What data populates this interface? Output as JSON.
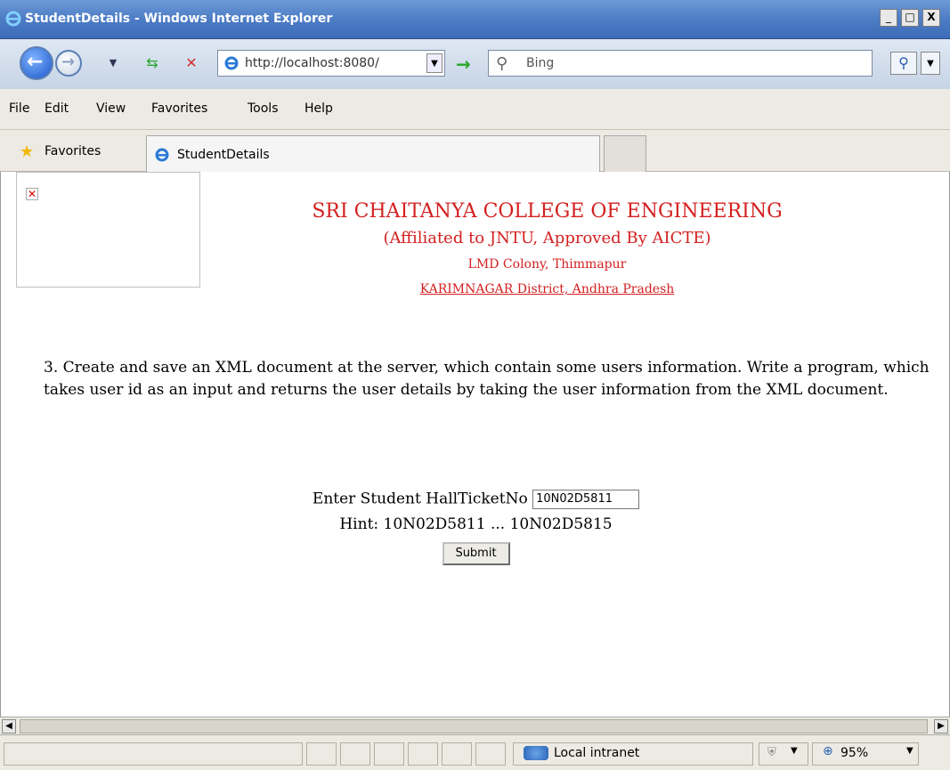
{
  "window": {
    "title": "StudentDetails - Windows Internet Explorer",
    "minimize": "_",
    "maximize": "□",
    "close": "X"
  },
  "address": {
    "url": "http://localhost:8080/",
    "search_placeholder": "Bing"
  },
  "menu": [
    "File",
    "Edit",
    "View",
    "Favorites",
    "Tools",
    "Help"
  ],
  "favorites": {
    "label": "Favorites",
    "tab_label": "StudentDetails"
  },
  "header": {
    "line1": "SRI CHAITANYA COLLEGE OF ENGINEERING",
    "line2": "(Affiliated to JNTU, Approved By AICTE)",
    "line3": "LMD Colony, Thimmapur",
    "line4": "KARIMNAGAR District, Andhra Pradesh"
  },
  "question": "3. Create and save an XML document at the server, which contain some users information. Write a program, which takes user id as an input and returns the user details by taking the user information from the XML document.",
  "form": {
    "label": "Enter Student HallTicketNo",
    "value": "10N02D5811",
    "hint": "Hint: 10N02D5811 ... 10N02D5815",
    "submit": "Submit"
  },
  "status": {
    "zone": "Local intranet",
    "zoom": "95%"
  },
  "icons": {
    "back": "back-arrow-icon",
    "forward": "forward-arrow-icon",
    "refresh": "refresh-icon",
    "stop": "stop-icon",
    "go": "go-arrow-icon",
    "search": "search-icon",
    "favorites": "star-icon"
  }
}
